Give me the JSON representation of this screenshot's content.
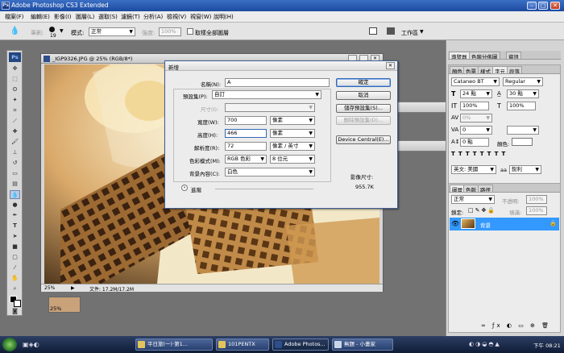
{
  "app": {
    "title": "Adobe Photoshop CS3 Extended",
    "logo": "Ps"
  },
  "menu": [
    "檔案(F)",
    "編輯(E)",
    "影像(I)",
    "圖層(L)",
    "選取(S)",
    "濾鏡(T)",
    "分析(A)",
    "檢視(V)",
    "視窗(W)",
    "說明(H)"
  ],
  "options_bar": {
    "mode_label": "筆刷:",
    "brush_size": "19",
    "mode2_label": "模式:",
    "mode_value": "正常",
    "strength_label": "強度:",
    "strength_value": "100%",
    "sample_all": "取樣全部圖層",
    "workspace_label": "工作區"
  },
  "document": {
    "title": "_IGP9326.JPG @ 25% (RGB/8*)",
    "zoom": "25%",
    "file_info": "文件: 17.2M/17.2M",
    "zoom_behind": "25%"
  },
  "dialog": {
    "title": "新增",
    "name_label": "名稱(N):",
    "name_value": "A",
    "preset_label": "預設集(P):",
    "preset_value": "自訂",
    "size_label": "尺寸(I):",
    "width_label": "寬度(W):",
    "width_value": "700",
    "width_unit": "像素",
    "height_label": "高度(H):",
    "height_value": "466",
    "height_unit": "像素",
    "res_label": "解析度(R):",
    "res_value": "72",
    "res_unit": "像素 / 英寸",
    "color_label": "色彩模式(M):",
    "color_value": "RGB 色彩",
    "depth_value": "8 位元",
    "bg_label": "背景內容(C):",
    "bg_value": "白色",
    "advanced": "進階",
    "ok": "確定",
    "cancel": "取消",
    "save_preset": "儲存預設集(S)...",
    "delete_preset": "刪除預設集(D)...",
    "device_central": "Device Central(E)...",
    "image_size_label": "影像尺寸:",
    "image_size_value": "955.7K"
  },
  "char_panel": {
    "tabs_top": [
      "導覽器",
      "色階分佈圖",
      "資訊"
    ],
    "tabs": [
      "顏色",
      "色票",
      "樣式",
      "字元",
      "段落"
    ],
    "font": "Cataneo BT",
    "style": "Regular",
    "size": "24 點",
    "leading": "30 點",
    "v_scale": "100%",
    "h_scale": "100%",
    "tracking": "0",
    "baseline": "0 點",
    "color_label": "顏色:",
    "percent": "0%",
    "lang": "英文: 美國",
    "aa_label": "aa",
    "aa": "銳利"
  },
  "layers_panel": {
    "tabs": [
      "圖層",
      "色版",
      "路徑"
    ],
    "blend": "正常",
    "opacity_label": "不透明:",
    "opacity": "100%",
    "lock_label": "鎖定:",
    "fill_label": "填滿:",
    "fill": "100%",
    "layer_name": "背景"
  },
  "taskbar": {
    "items": [
      "平日旅(一)·第1...",
      "101PENTX",
      "Adobe Photos...",
      "無題 - 小畫家"
    ],
    "clock": "下午 08:21"
  },
  "colors": {
    "accent": "#3366cc",
    "selection": "#3399ff"
  }
}
